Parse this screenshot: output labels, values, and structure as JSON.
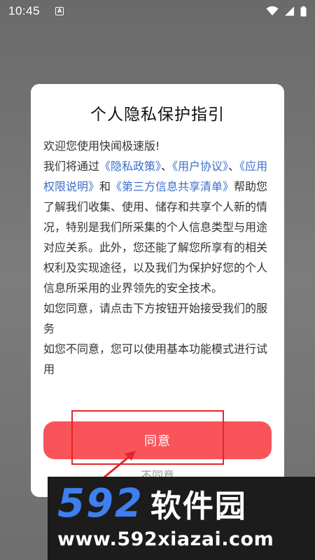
{
  "status_bar": {
    "time": "10:45",
    "notification_icon_letter": "A",
    "icons": [
      "wifi-icon",
      "cellular-signal-icon",
      "battery-icon"
    ]
  },
  "dialog": {
    "title": "个人隐私保护指引",
    "greeting": "欢迎您使用快闻极速版!",
    "intro_prefix": "我们将通过",
    "link_privacy_policy": "《隐私政策》",
    "sep1": "、",
    "link_user_agreement": "《用户协议》",
    "sep2": "、",
    "link_app_permissions": "《应用权限说明》",
    "and": "和",
    "link_third_party": "《第三方信息共享清单》",
    "intro_body": "帮助您了解我们收集、使用、储存和共享个人新的情况，特别是我们所采集的个人信息类型与用途对应关系。此外，您还能了解您所享有的相关权利及实现途径，以及我们为保护好您的个人信息所采用的业界领先的安全技术。",
    "agree_hint": "如您同意，请点击下方按钮开始接受我们的服务",
    "disagree_hint": "如您不同意，您可以使用基本功能模式进行试用",
    "agree_label": "同意",
    "disagree_label": "不同意"
  },
  "watermark": {
    "brand_number": "592",
    "brand_name": "软件园",
    "url": "www.592xiazai.com"
  },
  "colors": {
    "accent": "#f95459",
    "link": "#3b6fc9",
    "annotation": "#e0282c",
    "watermark_blue": "#3f7ff0"
  }
}
